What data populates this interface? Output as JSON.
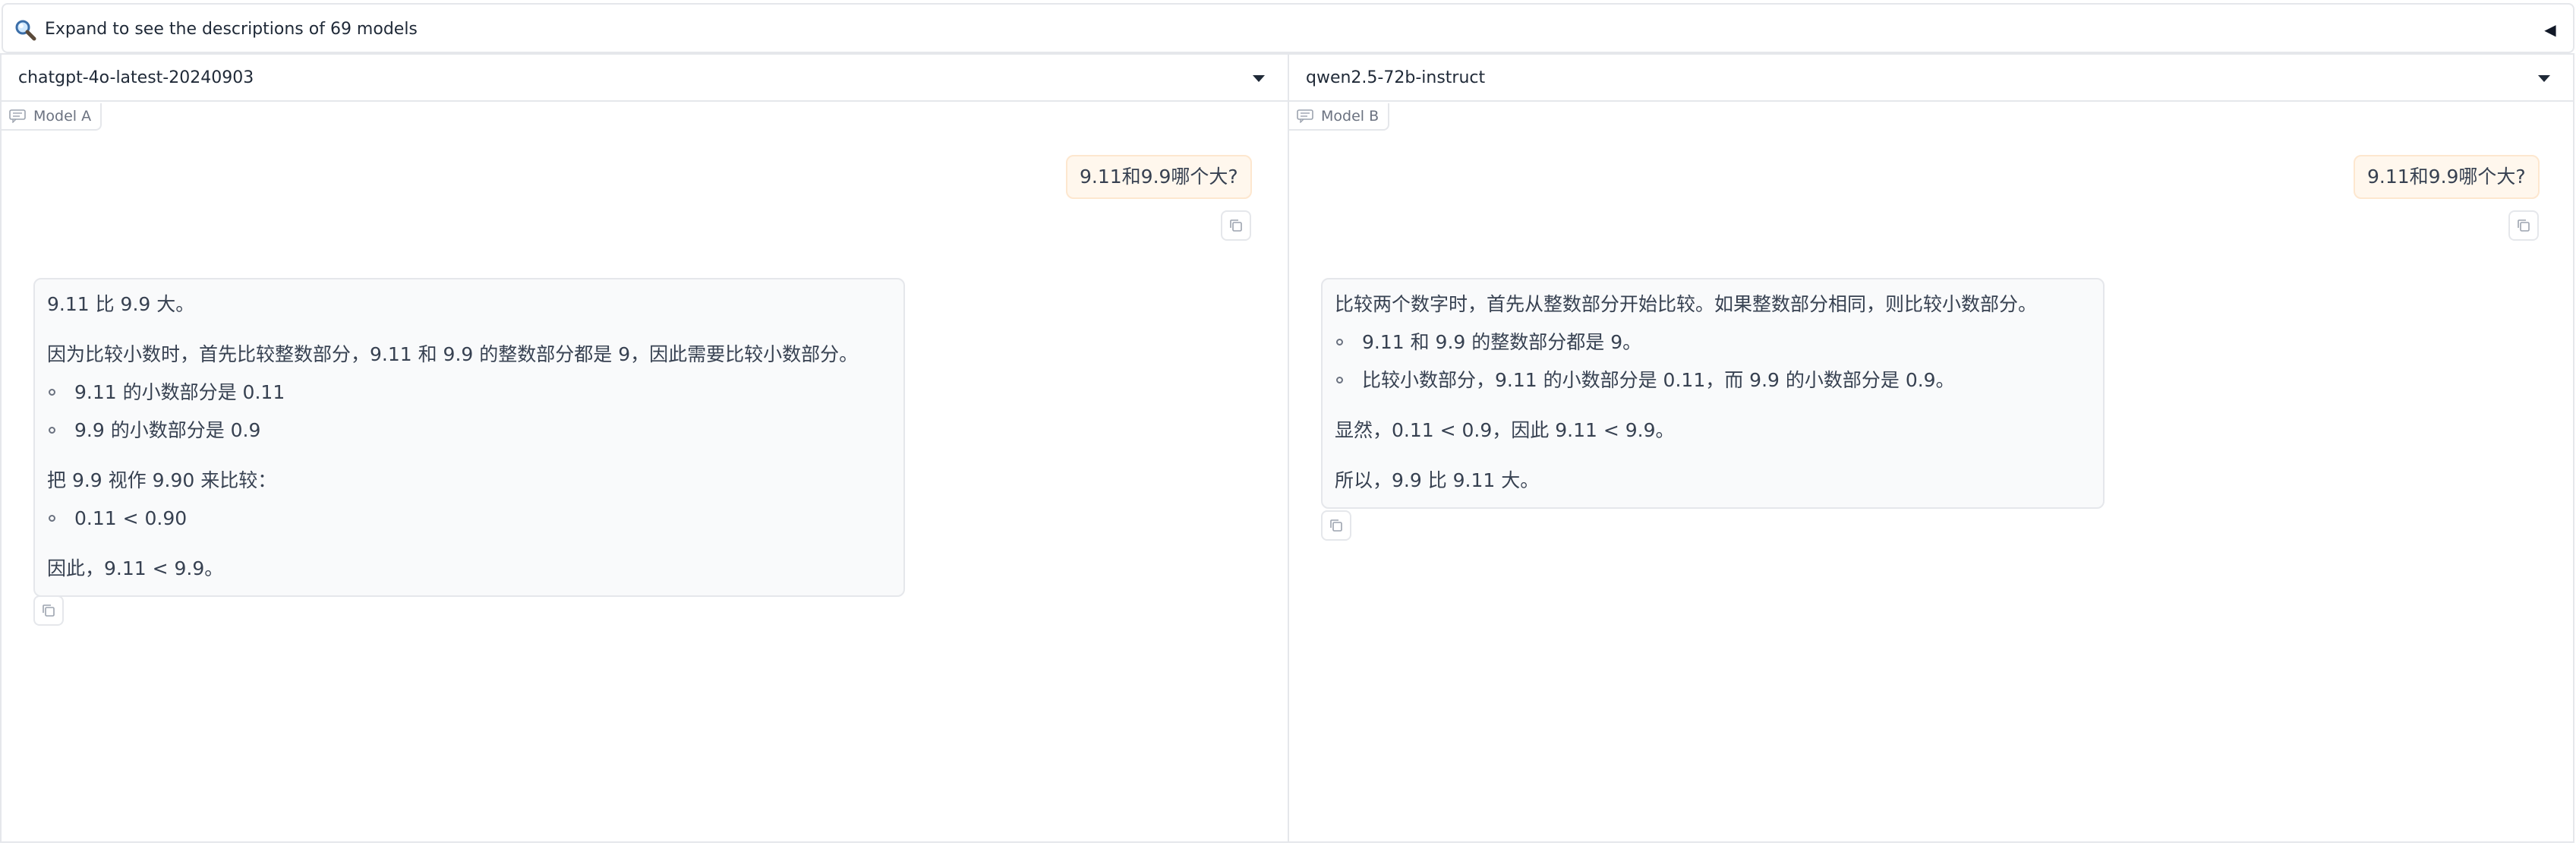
{
  "accordion": {
    "label": "Expand to see the descriptions of 69 models",
    "icon": "magnifier-icon",
    "toggle": "◀"
  },
  "panels": [
    {
      "model_select": "chatgpt-4o-latest-20240903",
      "tag": "Model A",
      "user_message": "9.11和9.9哪个大?",
      "bot_message": {
        "p1": "9.11 比 9.9 大。",
        "p2": "因为比较小数时，首先比较整数部分，9.11 和 9.9 的整数部分都是 9，因此需要比较小数部分。",
        "list1": [
          "9.11 的小数部分是 0.11",
          "9.9 的小数部分是 0.9"
        ],
        "p3": "把 9.9 视作 9.90 来比较：",
        "list2": [
          "0.11 < 0.90"
        ],
        "p4": "因此，9.11 < 9.9。"
      }
    },
    {
      "model_select": "qwen2.5-72b-instruct",
      "tag": "Model B",
      "user_message": "9.11和9.9哪个大?",
      "bot_message": {
        "p1": "比较两个数字时，首先从整数部分开始比较。如果整数部分相同，则比较小数部分。",
        "list1": [
          "9.11 和 9.9 的整数部分都是 9。",
          "比较小数部分，9.11 的小数部分是 0.11，而 9.9 的小数部分是 0.9。"
        ],
        "p2": "显然，0.11 < 0.9，因此 9.11 < 9.9。",
        "p3": "所以，9.9 比 9.11 大。"
      }
    }
  ]
}
